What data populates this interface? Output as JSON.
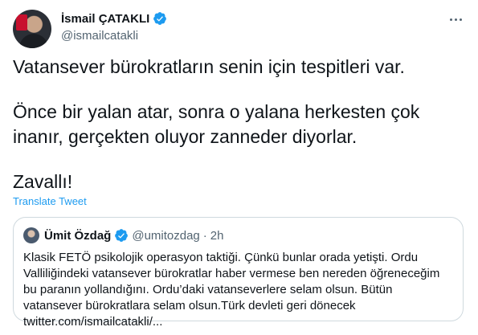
{
  "tweet": {
    "author": {
      "name": "İsmail ÇATAKLI",
      "handle": "@ismailcatakli",
      "avatar_icon": "profile-photo-icon",
      "verified_icon": "verified-badge-icon"
    },
    "more_icon": "more-options-icon",
    "text": [
      "Vatansever bürokratların senin için tespitleri var.",
      "Önce bir yalan atar, sonra o yalana herkesten çok inanır, gerçekten oluyor zanneder diyorlar.",
      "Zavallı!"
    ],
    "translate_label": "Translate Tweet"
  },
  "quote": {
    "author": {
      "name": "Ümit Özdağ",
      "handle": "@umitozdag",
      "separator": "·",
      "time": "2h",
      "verified_icon": "verified-badge-icon"
    },
    "text": "Klasik FETÖ psikolojik operasyon taktiği. Çünkü bunlar orada yetişti. Ordu Valliliğindeki vatansever bürokratlar haber vermese ben nereden öğreneceğim bu paranın yollandığını. Ordu’daki vatanseverlere selam olsun. Bütün vatansever bürokratlara selam olsun.Türk devleti geri dönecek twitter.com/ismailcatakli/..."
  },
  "colors": {
    "accent": "#1d9bf0",
    "text": "#0f1419",
    "secondary": "#536471",
    "border": "#cfd9de"
  }
}
